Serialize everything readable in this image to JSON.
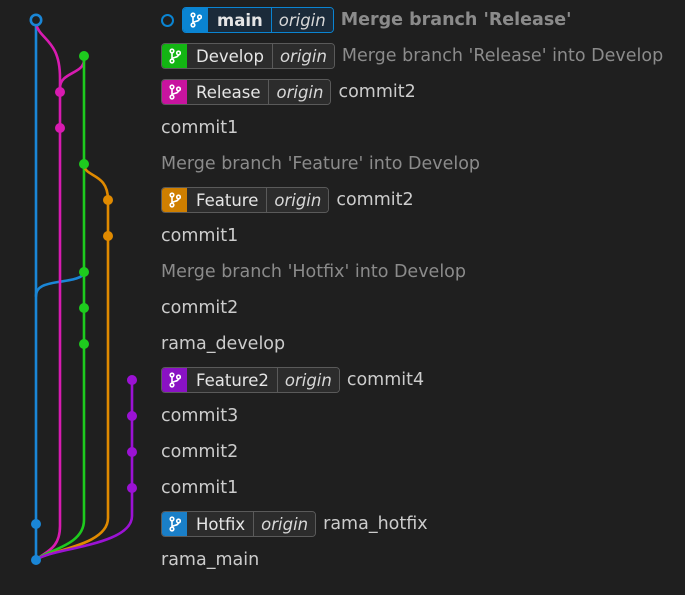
{
  "colors": {
    "main": "#1a86d6",
    "develop": "#1ecb1e",
    "release": "#d81bb1",
    "feature": "#e08a00",
    "feature2": "#9b12d4",
    "hotfix": "#1a86d6",
    "background": "#1f1f1f"
  },
  "icon": "branch-icon",
  "commits": [
    {
      "message": "Merge branch 'Release'",
      "ref": {
        "name": "main",
        "remote": "origin",
        "color": "#0a84d2"
      },
      "kind": "head"
    },
    {
      "message": "Merge branch 'Release' into Develop",
      "ref": {
        "name": "Develop",
        "remote": "origin",
        "color": "#13b513"
      },
      "kind": "merge"
    },
    {
      "message": "commit2",
      "ref": {
        "name": "Release",
        "remote": "origin",
        "color": "#c8149f"
      },
      "kind": "normal"
    },
    {
      "message": "commit1",
      "kind": "normal"
    },
    {
      "message": "Merge branch 'Feature' into Develop",
      "kind": "merge"
    },
    {
      "message": "commit2",
      "ref": {
        "name": "Feature",
        "remote": "origin",
        "color": "#cf7f00"
      },
      "kind": "normal"
    },
    {
      "message": "commit1",
      "kind": "normal"
    },
    {
      "message": "Merge branch 'Hotfix' into Develop",
      "kind": "merge"
    },
    {
      "message": "commit2",
      "kind": "normal"
    },
    {
      "message": "rama_develop",
      "kind": "normal"
    },
    {
      "message": "commit4",
      "ref": {
        "name": "Feature2",
        "remote": "origin",
        "color": "#8a12c4"
      },
      "kind": "normal"
    },
    {
      "message": "commit3",
      "kind": "normal"
    },
    {
      "message": "commit2",
      "kind": "normal"
    },
    {
      "message": "commit1",
      "kind": "normal"
    },
    {
      "message": "rama_hotfix",
      "ref": {
        "name": "Hotfix",
        "remote": "origin",
        "color": "#1a7fc8"
      },
      "kind": "normal"
    },
    {
      "message": "rama_main",
      "kind": "normal"
    }
  ]
}
